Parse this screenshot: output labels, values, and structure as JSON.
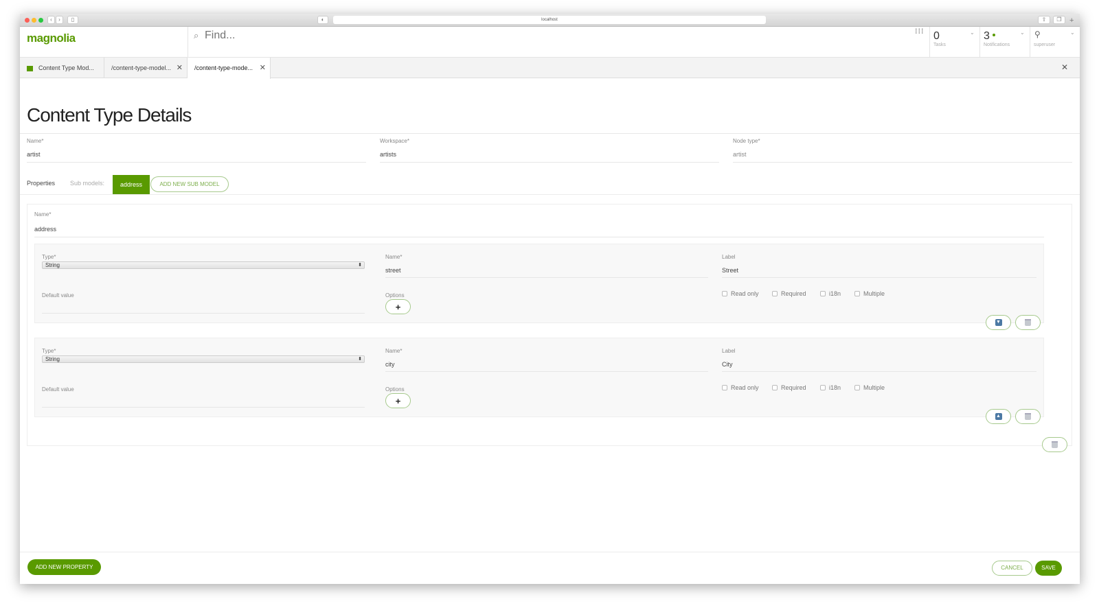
{
  "browser": {
    "url": "localhost"
  },
  "header": {
    "logo": "magnolia",
    "search_placeholder": "Find...",
    "tasks": {
      "count": "0",
      "label": "Tasks"
    },
    "notifications": {
      "count": "3",
      "label": "Notifications"
    },
    "user": {
      "label": "superuser"
    }
  },
  "tabs": [
    {
      "label": "Content Type Mod..."
    },
    {
      "label": "/content-type-model..."
    },
    {
      "label": "/content-type-mode...",
      "active": true
    }
  ],
  "page": {
    "title": "Content Type Details"
  },
  "fields": [
    {
      "label": "Name*",
      "value": "artist"
    },
    {
      "label": "Workspace*",
      "value": "artists"
    },
    {
      "label": "Node type*",
      "value": "artist"
    }
  ],
  "submodels": {
    "properties_label": "Properties",
    "label": "Sub models:",
    "items": [
      "address"
    ],
    "add_label": "ADD NEW SUB MODEL"
  },
  "submodel": {
    "name_label": "Name*",
    "name_value": "address",
    "properties": [
      {
        "type_label": "Type*",
        "type": "String",
        "name_label": "Name*",
        "name": "street",
        "label_label": "Label",
        "label": "Street",
        "default_label": "Default value",
        "options_label": "Options",
        "checks": [
          "Read only",
          "Required",
          "i18n",
          "Multiple"
        ],
        "move": "down"
      },
      {
        "type_label": "Type*",
        "type": "String",
        "name_label": "Name*",
        "name": "city",
        "label_label": "Label",
        "label": "City",
        "default_label": "Default value",
        "options_label": "Options",
        "checks": [
          "Read only",
          "Required",
          "i18n",
          "Multiple"
        ],
        "move": "up"
      }
    ]
  },
  "footer": {
    "add_property": "ADD NEW PROPERTY",
    "cancel": "CANCEL",
    "save": "SAVE"
  },
  "colors": {
    "accent": "#599a00"
  }
}
